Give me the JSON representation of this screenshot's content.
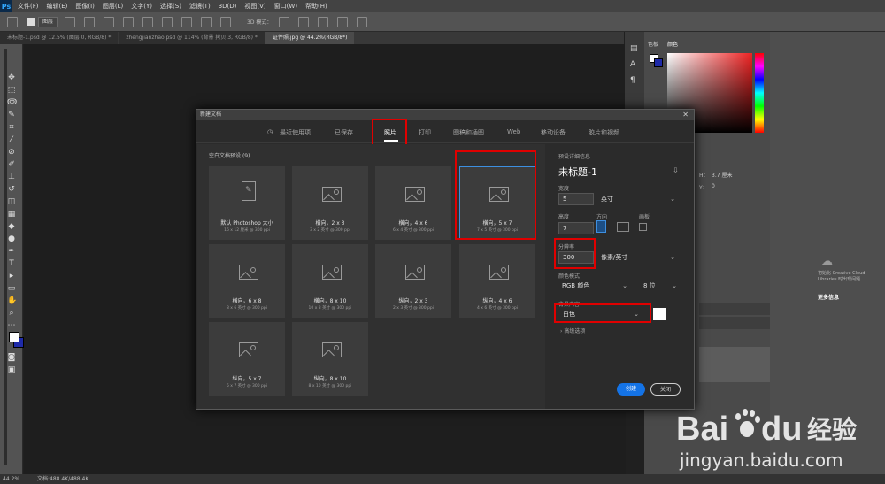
{
  "app": {
    "logo_text": "Ps"
  },
  "menu": [
    "文件(F)",
    "编辑(E)",
    "图像(I)",
    "图层(L)",
    "文字(Y)",
    "选择(S)",
    "滤镜(T)",
    "3D(D)",
    "视图(V)",
    "窗口(W)",
    "帮助(H)"
  ],
  "options": {
    "mode_select": "图层",
    "mode3d": "3D 模式："
  },
  "doc_tabs": [
    {
      "label": "未标题-1.psd @ 12.5% (图层 0, RGB/8) *",
      "active": false
    },
    {
      "label": "zhengjianzhao.psd @ 114% (背景 拷贝 3, RGB/8) *",
      "active": false
    },
    {
      "label": "证件照.jpg @ 44.2%(RGB/8*)",
      "active": true
    }
  ],
  "status": {
    "zoom": "44.2%",
    "doc": "文档:488.4K/488.4K"
  },
  "panels": {
    "tabs": [
      "色板",
      "颜色"
    ],
    "info_h": "H：",
    "info_h_val": "3.7 厘米",
    "info_y": "Y：",
    "info_y_val": "0",
    "cc_text": "初始化 Creative Cloud Libraries 时出现问题",
    "cc_link": "更多信息"
  },
  "dialog": {
    "title": "新建文档",
    "tabs": [
      {
        "label": "最近使用项",
        "active": false
      },
      {
        "label": "已保存",
        "active": false
      },
      {
        "label": "照片",
        "active": true
      },
      {
        "label": "打印",
        "active": false
      },
      {
        "label": "图稿和插图",
        "active": false
      },
      {
        "label": "Web",
        "active": false
      },
      {
        "label": "移动设备",
        "active": false
      },
      {
        "label": "胶片和视频",
        "active": false
      }
    ],
    "presets_label": "空白文档预设",
    "presets_count": "(9)",
    "presets": [
      {
        "name": "默认 Photoshop 大小",
        "desc": "16 x 12 厘米 @ 300 ppi",
        "icon": "document-icon",
        "selected": false
      },
      {
        "name": "横向，2 x 3",
        "desc": "3 x 2 英寸 @ 300 ppi",
        "icon": "image-icon",
        "selected": false
      },
      {
        "name": "横向，4 x 6",
        "desc": "6 x 4 英寸 @ 300 ppi",
        "icon": "image-icon",
        "selected": false
      },
      {
        "name": "横向，5 x 7",
        "desc": "7 x 5 英寸 @ 300 ppi",
        "icon": "image-icon",
        "selected": true
      },
      {
        "name": "横向，6 x 8",
        "desc": "8 x 6 英寸 @ 300 ppi",
        "icon": "image-icon",
        "selected": false
      },
      {
        "name": "横向，8 x 10",
        "desc": "10 x 8 英寸 @ 300 ppi",
        "icon": "image-icon",
        "selected": false
      },
      {
        "name": "纵向，2 x 3",
        "desc": "2 x 3 英寸 @ 300 ppi",
        "icon": "image-icon",
        "selected": false
      },
      {
        "name": "纵向，4 x 6",
        "desc": "4 x 6 英寸 @ 300 ppi",
        "icon": "image-icon",
        "selected": false
      },
      {
        "name": "纵向，5 x 7",
        "desc": "5 x 7 英寸 @ 300 ppi",
        "icon": "image-icon",
        "selected": false
      },
      {
        "name": "纵向，8 x 10",
        "desc": "8 x 10 英寸 @ 300 ppi",
        "icon": "image-icon",
        "selected": false
      }
    ],
    "details": {
      "section_label": "预设详细信息",
      "doc_name": "未标题-1",
      "width_label": "宽度",
      "width_value": "5",
      "width_unit": "英寸",
      "height_label": "高度",
      "height_value": "7",
      "orientation_label": "方向",
      "artboard_label": "画板",
      "resolution_label": "分辨率",
      "resolution_value": "300",
      "resolution_unit": "像素/英寸",
      "color_mode_label": "颜色模式",
      "color_mode_value": "RGB 颜色",
      "bit_depth": "8 位",
      "background_label": "背景内容",
      "background_value": "白色",
      "advanced_label": "高级选项",
      "create_button": "创建",
      "close_button": "关闭"
    }
  },
  "watermark": {
    "brand_left": "Bai",
    "brand_right": "du",
    "brand_cn": "经验",
    "url": "jingyan.baidu.com"
  },
  "colors": {
    "accent": "#1473e6",
    "highlight": "#e00000",
    "selected_border": "#3d8fe0"
  }
}
